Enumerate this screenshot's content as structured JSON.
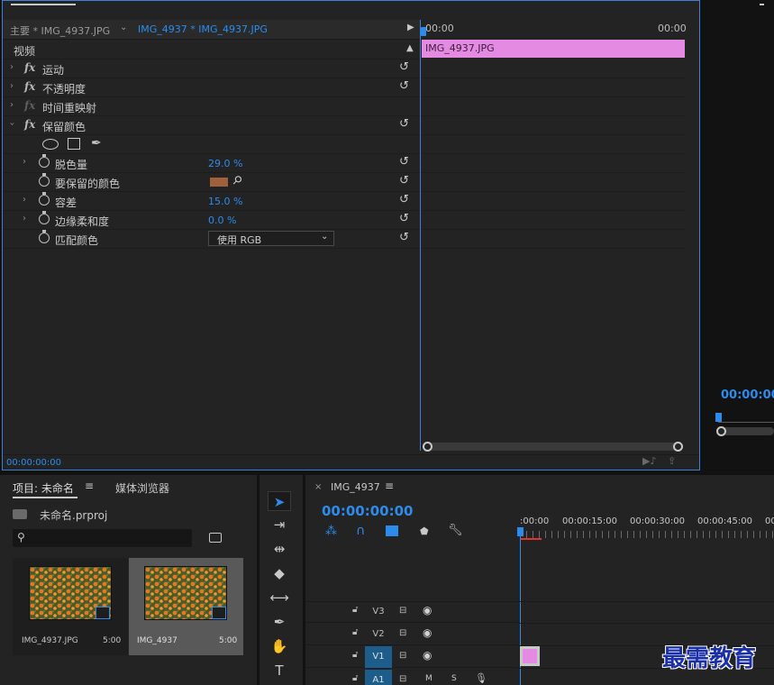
{
  "effect_controls": {
    "tab_master": "主要 * IMG_4937.JPG",
    "tab_clip": "IMG_4937 * IMG_4937.JPG",
    "section_video": "视频",
    "timeline_start": "00:00",
    "timeline_end": "00:00",
    "clip_label": "IMG_4937.JPG",
    "current_time": "00:00:00:00",
    "effects": [
      {
        "label": "运动"
      },
      {
        "label": "不透明度"
      },
      {
        "label": "时间重映射"
      },
      {
        "label": "保留颜色"
      }
    ],
    "params": {
      "decolor": {
        "label": "脱色量",
        "value": "29.0 %"
      },
      "color_to_keep": {
        "label": "要保留的颜色",
        "color": "#a0603c"
      },
      "tolerance": {
        "label": "容差",
        "value": "15.0 %"
      },
      "edge_softness": {
        "label": "边缘柔和度",
        "value": "0.0 %"
      },
      "match_colors": {
        "label": "匹配颜色",
        "value": "使用 RGB"
      }
    }
  },
  "program_monitor": {
    "timecode": "00:00:00"
  },
  "project_panel": {
    "tab_project": "项目: 未命名",
    "tab_media_browser": "媒体浏览器",
    "project_file": "未命名.prproj",
    "search_placeholder": "",
    "items": [
      {
        "name": "IMG_4937.JPG",
        "duration": "5:00"
      },
      {
        "name": "IMG_4937",
        "duration": "5:00"
      }
    ]
  },
  "timeline_panel": {
    "sequence_name": "IMG_4937",
    "timecode": "00:00:00:00",
    "ruler": [
      ":00:00",
      "00:00:15:00",
      "00:00:30:00",
      "00:00:45:00",
      "00"
    ],
    "tracks": [
      {
        "name": "V3"
      },
      {
        "name": "V2"
      },
      {
        "name": "V1"
      },
      {
        "name": "A1",
        "m": "M",
        "s": "S"
      }
    ]
  },
  "watermark": "最需教育",
  "colors": {
    "accent": "#2d8ceb",
    "clip": "#e58ae2",
    "panel_bg": "#232323",
    "selected_track": "#1d5d8c"
  }
}
